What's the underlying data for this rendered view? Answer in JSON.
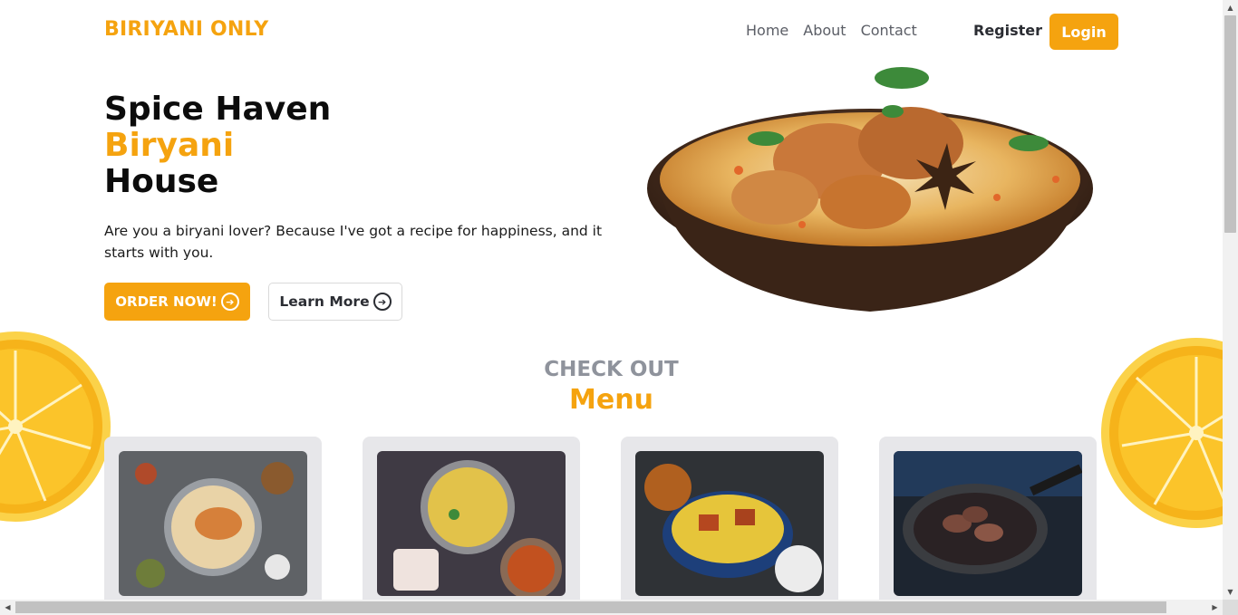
{
  "brand": "BIRIYANI ONLY",
  "nav": {
    "items": [
      "Home",
      "About",
      "Contact"
    ],
    "register": "Register",
    "login": "Login"
  },
  "hero": {
    "line1": "Spice Haven",
    "line2": "Biryani",
    "line3": "House",
    "description": "Are you a biryani lover? Because I've got a recipe for happiness, and it starts with you.",
    "order_label": "ORDER NOW!",
    "learn_label": "Learn More"
  },
  "menu": {
    "kicker": "CHECK OUT",
    "title": "Menu"
  },
  "colors": {
    "accent": "#f5a30f",
    "muted": "#8f939c"
  },
  "icons": [
    "arrow-circle-right-icon",
    "arrow-circle-right-icon"
  ]
}
